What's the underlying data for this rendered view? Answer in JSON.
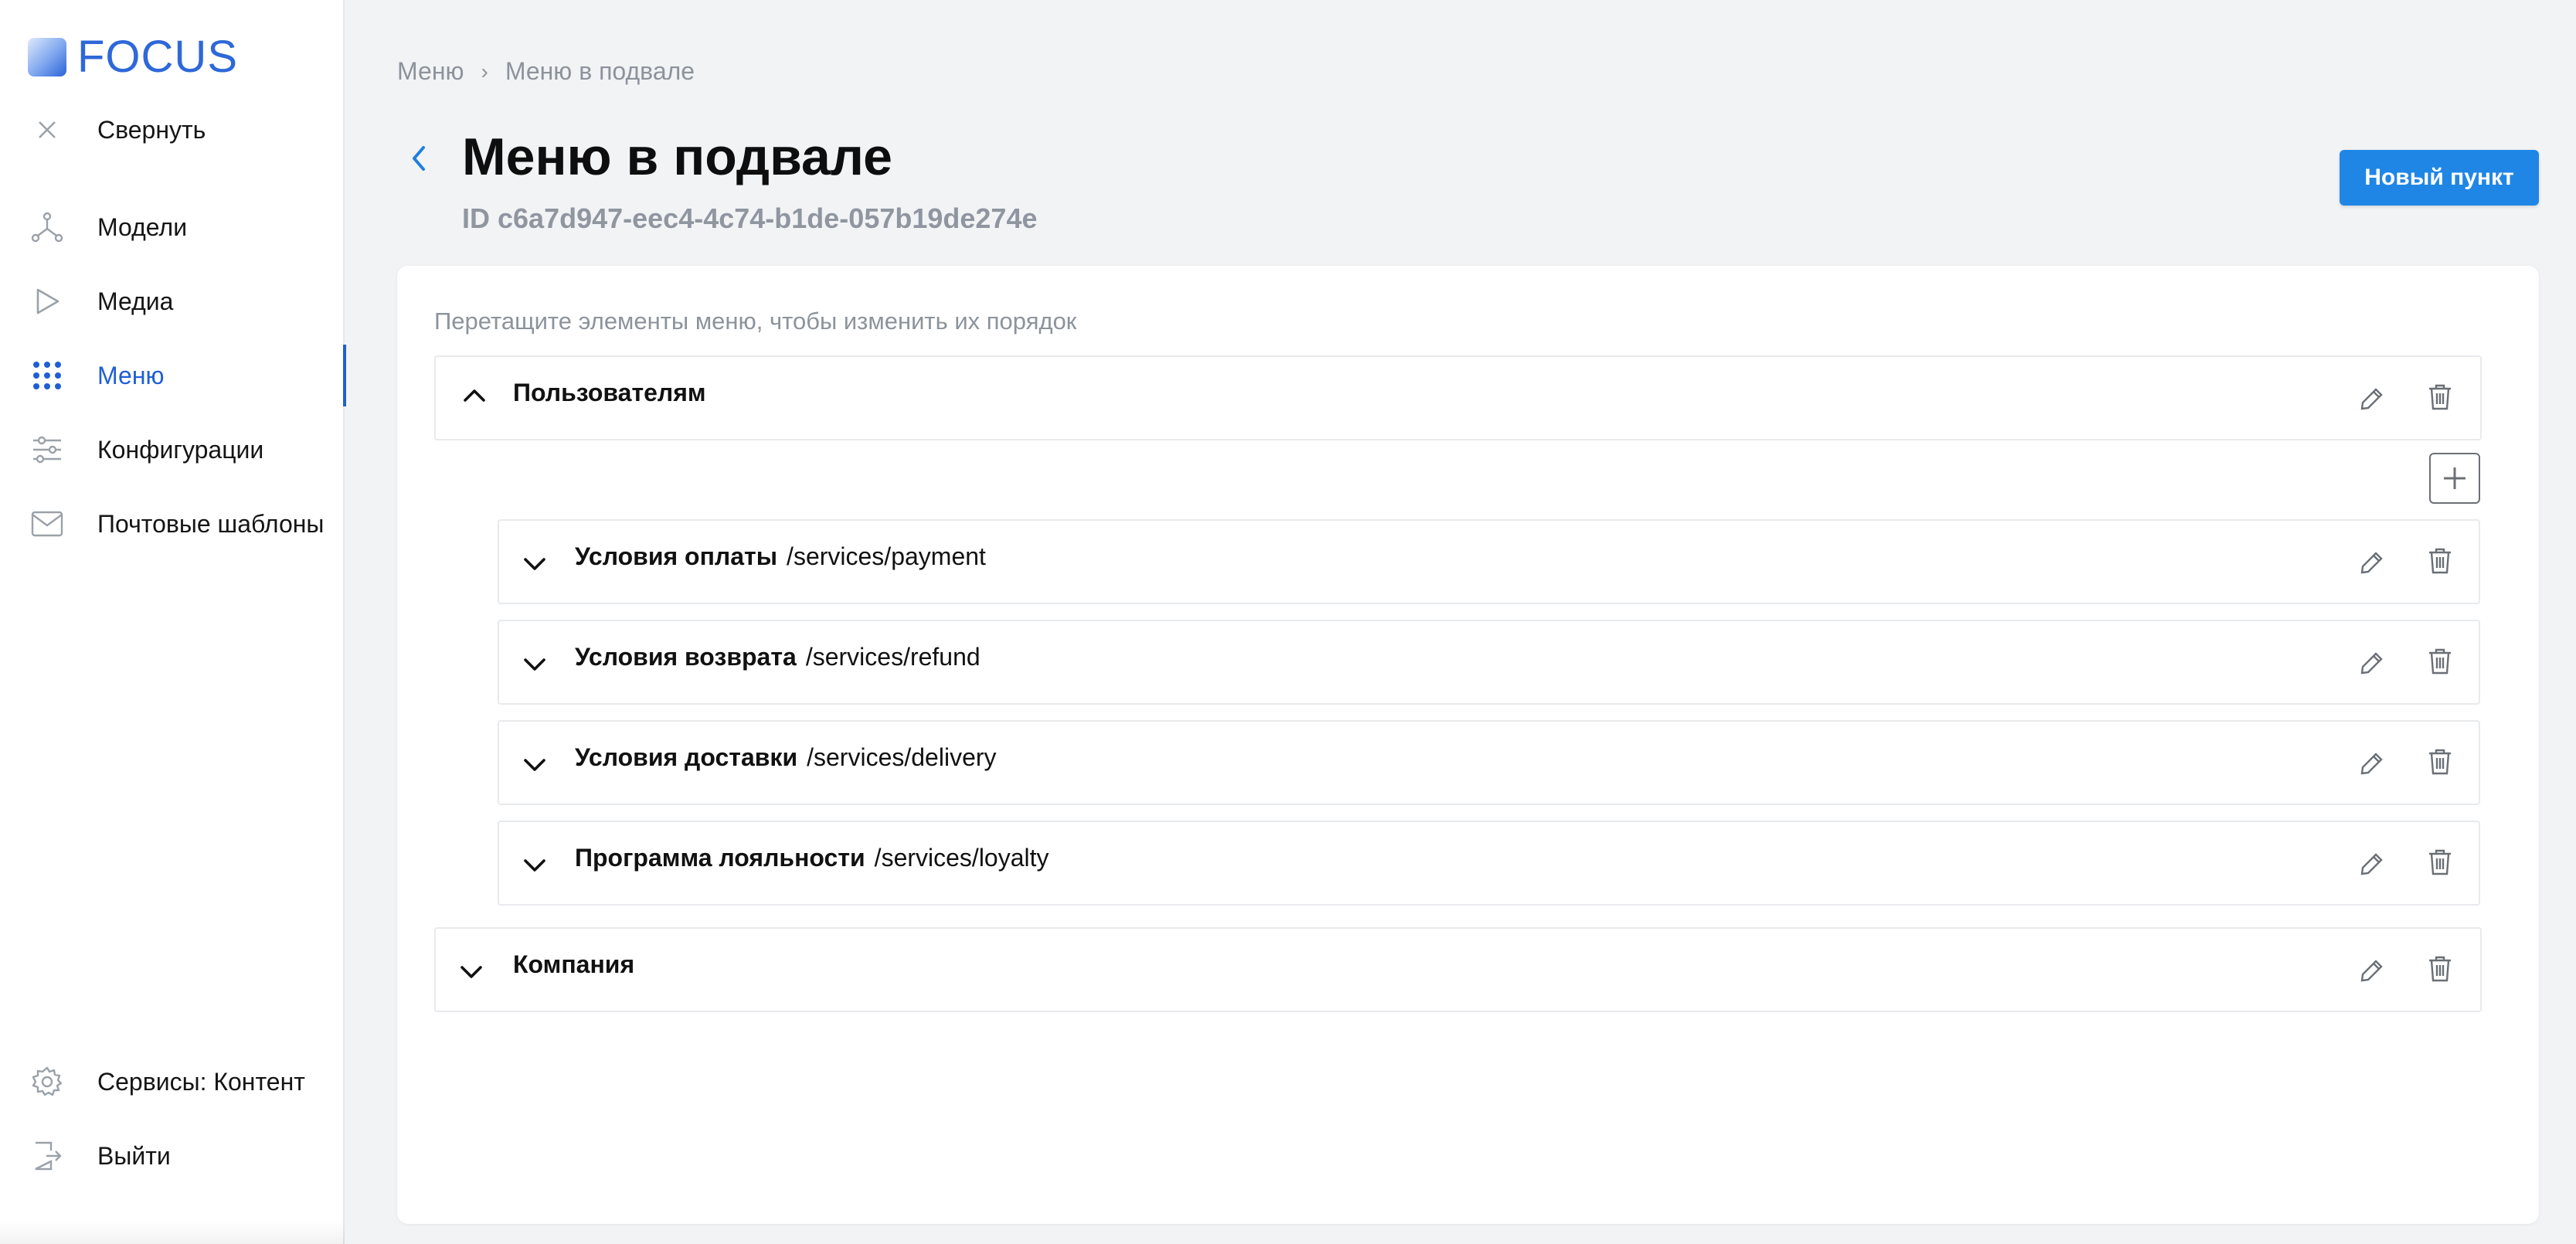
{
  "brand": {
    "name": "FOCUS"
  },
  "sidebar": {
    "collapse_label": "Свернуть",
    "items": [
      {
        "label": "Модели",
        "icon": "models-icon"
      },
      {
        "label": "Медиа",
        "icon": "media-play-icon"
      },
      {
        "label": "Меню",
        "icon": "menu-grid-icon",
        "active": true
      },
      {
        "label": "Конфигурации",
        "icon": "sliders-icon"
      },
      {
        "label": "Почтовые шаблоны",
        "icon": "mail-icon"
      }
    ],
    "bottom": [
      {
        "label": "Сервисы: Контент",
        "icon": "gear-icon"
      },
      {
        "label": "Выйти",
        "icon": "logout-icon"
      }
    ]
  },
  "breadcrumb": {
    "root": "Меню",
    "current": "Меню в подвале"
  },
  "page": {
    "title": "Меню в подвале",
    "id_text": "ID c6a7d947-eec4-4c74-b1de-057b19de274e",
    "new_button": "Новый пункт",
    "hint": "Перетащите элементы меню, чтобы изменить их порядок"
  },
  "menu": {
    "groups": [
      {
        "title": "Пользователям",
        "expanded": true,
        "children": [
          {
            "title": "Условия оплаты",
            "path": "/services/payment"
          },
          {
            "title": "Условия возврата",
            "path": "/services/refund"
          },
          {
            "title": "Условия доставки",
            "path": "/services/delivery"
          },
          {
            "title": "Программа лояльности",
            "path": "/services/loyalty"
          }
        ]
      },
      {
        "title": "Компания",
        "expanded": false
      }
    ]
  },
  "colors": {
    "accent": "#1f5ed5",
    "button": "#1f86e6",
    "muted": "#8c939c"
  }
}
